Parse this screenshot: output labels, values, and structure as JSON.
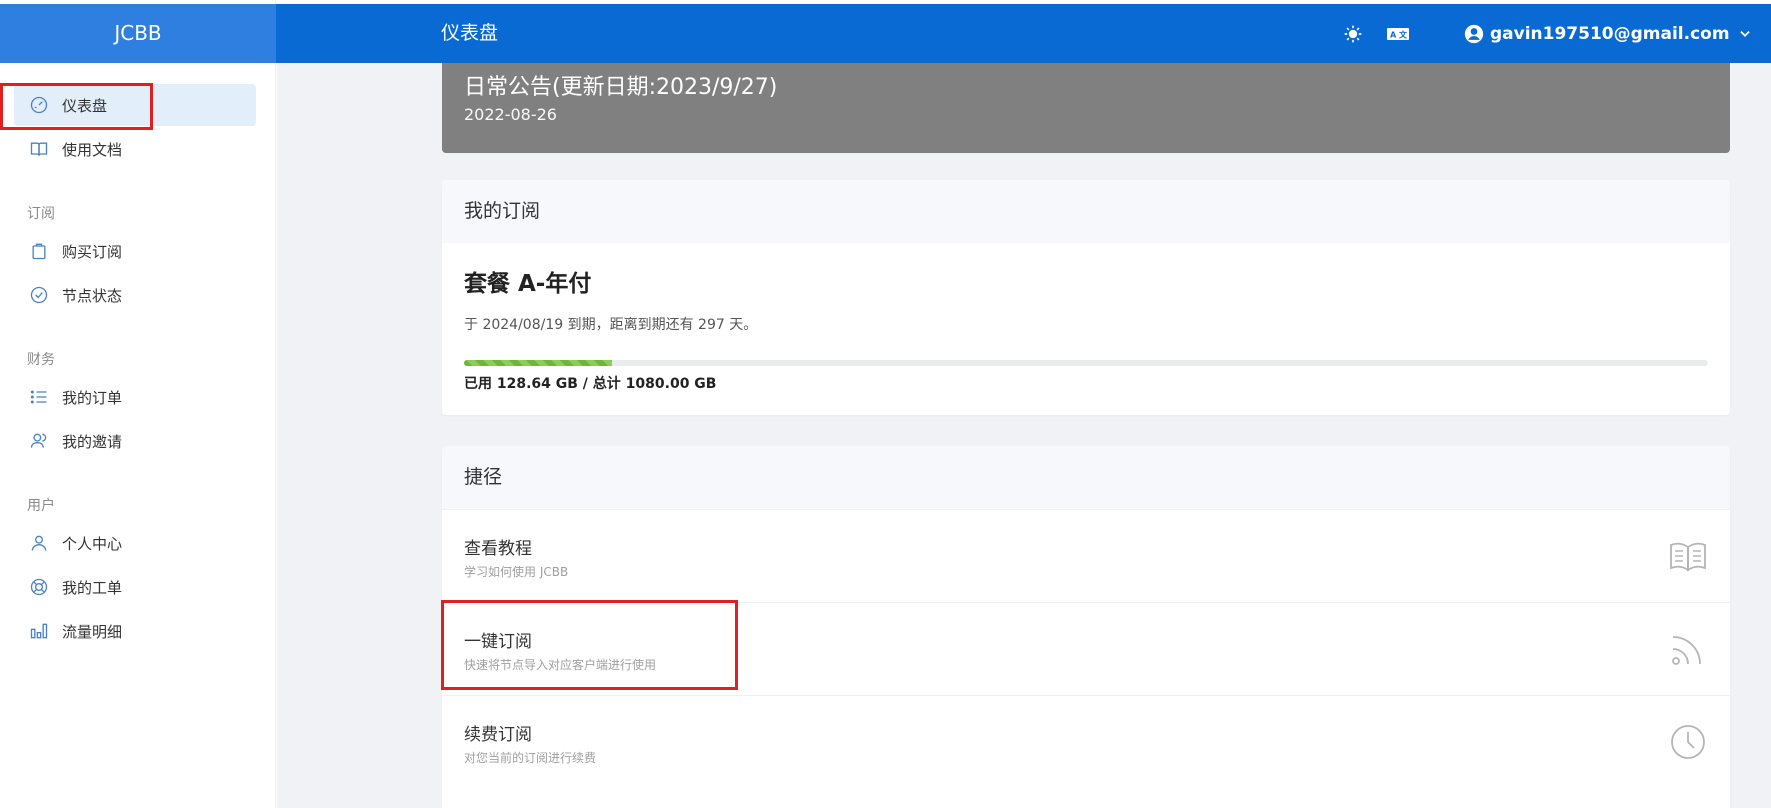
{
  "brand": "JCBB",
  "header": {
    "title": "仪表盘",
    "theme_icon": "sun-icon",
    "lang_icon": "translate-icon",
    "user_email": "gavin197510@gmail.com"
  },
  "sidebar": {
    "items_top": [
      {
        "label": "仪表盘",
        "icon": "dashboard-icon",
        "active": true
      },
      {
        "label": "使用文档",
        "icon": "book-icon"
      }
    ],
    "sections": [
      {
        "label": "订阅",
        "items": [
          {
            "label": "购买订阅",
            "icon": "bag-icon"
          },
          {
            "label": "节点状态",
            "icon": "check-circle-icon"
          }
        ]
      },
      {
        "label": "财务",
        "items": [
          {
            "label": "我的订单",
            "icon": "list-icon"
          },
          {
            "label": "我的邀请",
            "icon": "users-icon"
          }
        ]
      },
      {
        "label": "用户",
        "items": [
          {
            "label": "个人中心",
            "icon": "user-icon"
          },
          {
            "label": "我的工单",
            "icon": "support-icon"
          },
          {
            "label": "流量明细",
            "icon": "bar-chart-icon"
          }
        ]
      }
    ]
  },
  "notice": {
    "title": "日常公告(更新日期:2023/9/27)",
    "date": "2022-08-26"
  },
  "subscription": {
    "header": "我的订阅",
    "plan": "套餐 A-年付",
    "expiry": "于 2024/08/19 到期，距离到期还有 297 天。",
    "usage_fraction": 0.119,
    "usage_text": "已用 128.64 GB / 总计 1080.00 GB"
  },
  "shortcuts": {
    "header": "捷径",
    "items": [
      {
        "title": "查看教程",
        "desc": "学习如何使用 JCBB",
        "icon": "book-open-icon"
      },
      {
        "title": "一键订阅",
        "desc": "快速将节点导入对应客户端进行使用",
        "icon": "rss-icon"
      },
      {
        "title": "续费订阅",
        "desc": "对您当前的订阅进行续费",
        "icon": "clock-icon"
      }
    ]
  },
  "colors": {
    "topbar": "#0a6ad4",
    "brand_bg": "#2f7fe0",
    "highlight": "#e02020",
    "progress": "#6fb53c"
  }
}
